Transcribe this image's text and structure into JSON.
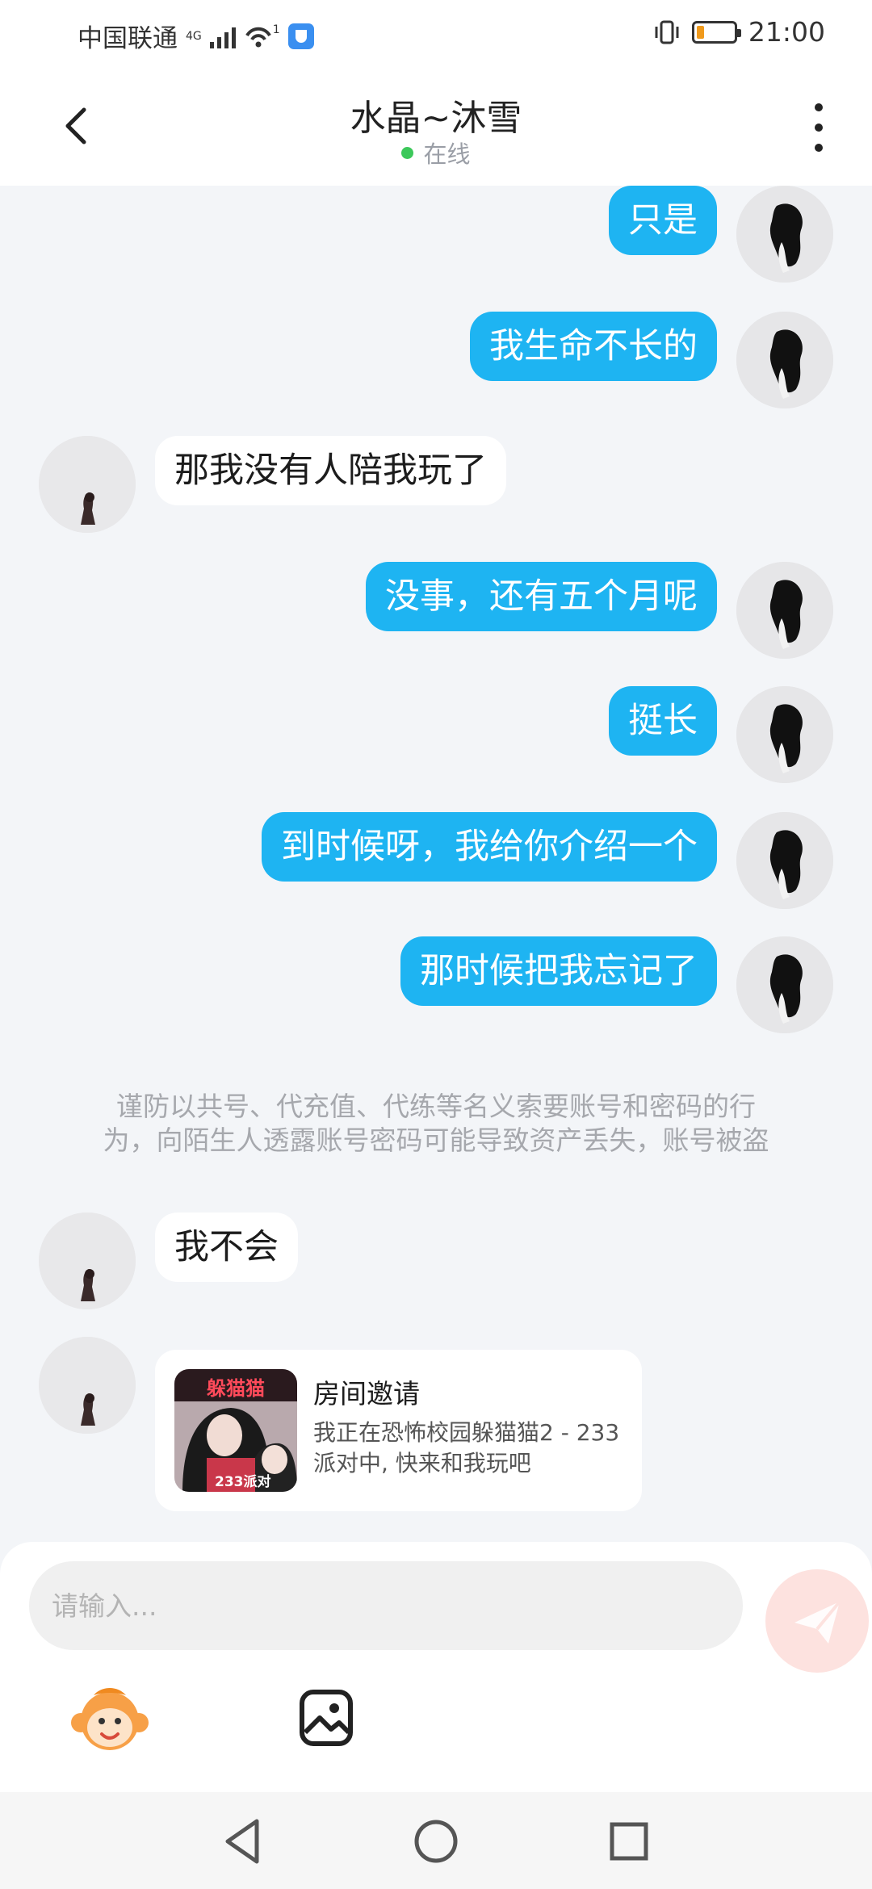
{
  "status_bar": {
    "carrier": "中国联通",
    "network_type": "4G",
    "wifi_badge": "1",
    "time": "21:00",
    "battery_percent": 20,
    "battery_color": "#f09a1c"
  },
  "header": {
    "title": "水晶~沐雪",
    "status": "在线",
    "status_color": "#3cc85a",
    "back_icon": "chevron-left-icon",
    "more_icon": "more-vertical-icon"
  },
  "messages": [
    {
      "sender": "me",
      "text": "只是"
    },
    {
      "sender": "me",
      "text": "我生命不长的"
    },
    {
      "sender": "other",
      "text": "那我没有人陪我玩了"
    },
    {
      "sender": "me",
      "text": "没事，还有五个月呢"
    },
    {
      "sender": "me",
      "text": "挺长"
    },
    {
      "sender": "me",
      "text": "到时候呀，我给你介绍一个"
    },
    {
      "sender": "me",
      "text": "那时候把我忘记了"
    },
    {
      "sender": "other",
      "text": "我不会"
    }
  ],
  "notice": {
    "line1": "谨防以共号、代充值、代练等名义索要账号和密码的行",
    "line2": "为，向陌生人透露账号密码可能导致资产丢失，账号被盗"
  },
  "invite_card": {
    "title": "房间邀请",
    "desc_line1": "我正在恐怖校园躲猫猫2 - 233",
    "desc_line2": "派对中, 快来和我玩吧",
    "image_caption_top": "躲猫猫",
    "image_caption_bottom": "233派对"
  },
  "input": {
    "placeholder": "请输入...",
    "value": ""
  },
  "toolbar": {
    "emoji_icon": "monkey-emoji-icon",
    "image_icon": "image-icon",
    "send_icon": "send-icon"
  },
  "colors": {
    "my_bubble": "#1eb4f2",
    "other_bubble": "#ffffff",
    "background": "#f3f5f8"
  }
}
